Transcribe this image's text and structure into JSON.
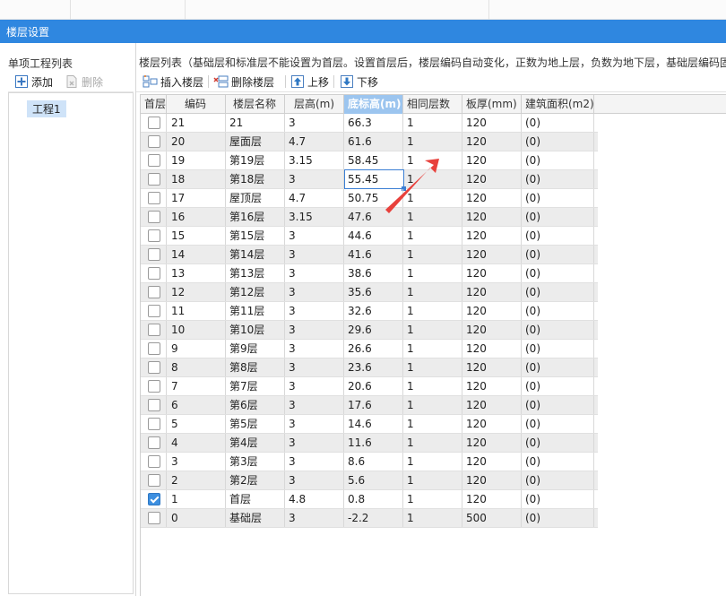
{
  "dialog": {
    "title": "楼层设置"
  },
  "left_panel": {
    "title": "单项工程列表",
    "add_label": "添加",
    "delete_label": "删除",
    "projects": [
      "工程1"
    ]
  },
  "right_panel": {
    "hint": "楼层列表（基础层和标准层不能设置为首层。设置首层后，楼层编码自动变化，正数为地上层，负数为地下层，基础层编码固",
    "toolbar": {
      "insert_label": "插入楼层",
      "delete_label": "删除楼层",
      "up_label": "上移",
      "down_label": "下移"
    },
    "columns": [
      "首层",
      "编码",
      "楼层名称",
      "层高(m)",
      "底标高(m)",
      "相同层数",
      "板厚(mm)",
      "建筑面积(m2)"
    ],
    "active_column": "底标高(m)",
    "rows": [
      {
        "first": false,
        "code": "21",
        "name": "21",
        "height": "3",
        "base": "66.3",
        "same": "1",
        "slab": "120",
        "area": "(0)"
      },
      {
        "first": false,
        "code": "20",
        "name": "屋面层",
        "height": "4.7",
        "base": "61.6",
        "same": "1",
        "slab": "120",
        "area": "(0)"
      },
      {
        "first": false,
        "code": "19",
        "name": "第19层",
        "height": "3.15",
        "base": "58.45",
        "same": "1",
        "slab": "120",
        "area": "(0)"
      },
      {
        "first": false,
        "code": "18",
        "name": "第18层",
        "height": "3",
        "base": "55.45",
        "same": "1",
        "slab": "120",
        "area": "(0)"
      },
      {
        "first": false,
        "code": "17",
        "name": "屋顶层",
        "height": "4.7",
        "base": "50.75",
        "same": "1",
        "slab": "120",
        "area": "(0)"
      },
      {
        "first": false,
        "code": "16",
        "name": "第16层",
        "height": "3.15",
        "base": "47.6",
        "same": "1",
        "slab": "120",
        "area": "(0)"
      },
      {
        "first": false,
        "code": "15",
        "name": "第15层",
        "height": "3",
        "base": "44.6",
        "same": "1",
        "slab": "120",
        "area": "(0)"
      },
      {
        "first": false,
        "code": "14",
        "name": "第14层",
        "height": "3",
        "base": "41.6",
        "same": "1",
        "slab": "120",
        "area": "(0)"
      },
      {
        "first": false,
        "code": "13",
        "name": "第13层",
        "height": "3",
        "base": "38.6",
        "same": "1",
        "slab": "120",
        "area": "(0)"
      },
      {
        "first": false,
        "code": "12",
        "name": "第12层",
        "height": "3",
        "base": "35.6",
        "same": "1",
        "slab": "120",
        "area": "(0)"
      },
      {
        "first": false,
        "code": "11",
        "name": "第11层",
        "height": "3",
        "base": "32.6",
        "same": "1",
        "slab": "120",
        "area": "(0)"
      },
      {
        "first": false,
        "code": "10",
        "name": "第10层",
        "height": "3",
        "base": "29.6",
        "same": "1",
        "slab": "120",
        "area": "(0)"
      },
      {
        "first": false,
        "code": "9",
        "name": "第9层",
        "height": "3",
        "base": "26.6",
        "same": "1",
        "slab": "120",
        "area": "(0)"
      },
      {
        "first": false,
        "code": "8",
        "name": "第8层",
        "height": "3",
        "base": "23.6",
        "same": "1",
        "slab": "120",
        "area": "(0)"
      },
      {
        "first": false,
        "code": "7",
        "name": "第7层",
        "height": "3",
        "base": "20.6",
        "same": "1",
        "slab": "120",
        "area": "(0)"
      },
      {
        "first": false,
        "code": "6",
        "name": "第6层",
        "height": "3",
        "base": "17.6",
        "same": "1",
        "slab": "120",
        "area": "(0)"
      },
      {
        "first": false,
        "code": "5",
        "name": "第5层",
        "height": "3",
        "base": "14.6",
        "same": "1",
        "slab": "120",
        "area": "(0)"
      },
      {
        "first": false,
        "code": "4",
        "name": "第4层",
        "height": "3",
        "base": "11.6",
        "same": "1",
        "slab": "120",
        "area": "(0)"
      },
      {
        "first": false,
        "code": "3",
        "name": "第3层",
        "height": "3",
        "base": "8.6",
        "same": "1",
        "slab": "120",
        "area": "(0)"
      },
      {
        "first": false,
        "code": "2",
        "name": "第2层",
        "height": "3",
        "base": "5.6",
        "same": "1",
        "slab": "120",
        "area": "(0)"
      },
      {
        "first": true,
        "code": "1",
        "name": "首层",
        "height": "4.8",
        "base": "0.8",
        "same": "1",
        "slab": "120",
        "area": "(0)"
      },
      {
        "first": false,
        "code": "0",
        "name": "基础层",
        "height": "3",
        "base": "-2.2",
        "same": "1",
        "slab": "500",
        "area": "(0)"
      }
    ],
    "selected_cell": {
      "row": "18",
      "column": "底标高(m)"
    }
  },
  "colors": {
    "titlebar": "#2f87e0",
    "active_header": "#9cc5ef",
    "arrow": "#e8413c",
    "checkbox_checked": "#3d8fe0"
  }
}
